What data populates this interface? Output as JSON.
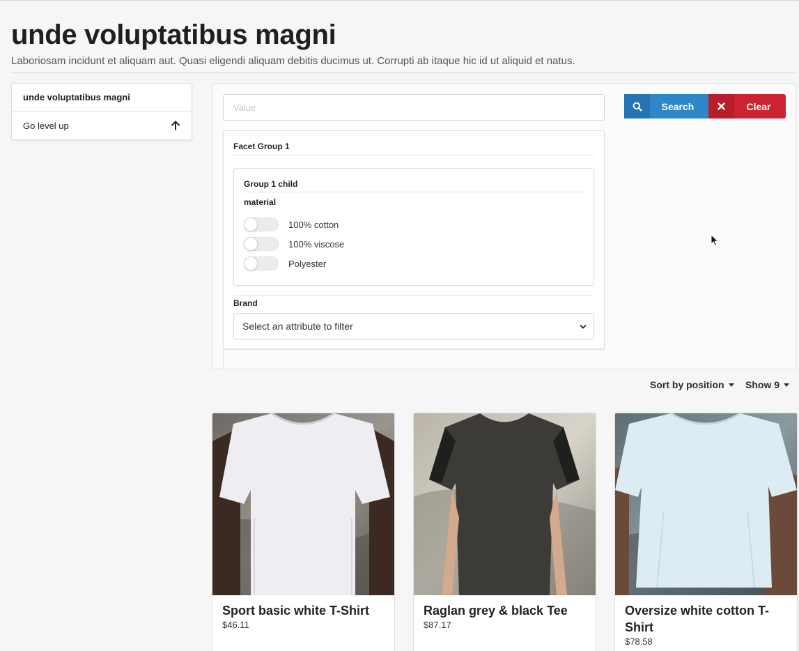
{
  "page": {
    "title": "unde voluptatibus magni",
    "subtitle": "Laboriosam incidunt et aliquam aut. Quasi eligendi aliquam debitis ducimus ut. Corrupti ab itaque hic id ut aliquid et natus."
  },
  "sidebar": {
    "category": "unde voluptatibus magni",
    "level_up_label": "Go level up",
    "level_up_icon": "arrow-up-icon"
  },
  "search": {
    "placeholder": "Value",
    "search_label": "Search",
    "search_icon": "search-icon",
    "clear_label": "Clear",
    "clear_icon": "close-icon"
  },
  "facets": {
    "group_title": "Facet Group 1",
    "child_title": "Group 1 child",
    "attribute_label": "material",
    "options": [
      "100% cotton",
      "100% viscose",
      "Polyester"
    ],
    "brand_label": "Brand",
    "brand_select": "Select an attribute to filter"
  },
  "sorting": {
    "sort_label": "Sort by position",
    "show_label": "Show 9"
  },
  "products": [
    {
      "name": "Sport basic white T-Shirt",
      "price": "$46.11"
    },
    {
      "name": "Raglan grey & black Tee",
      "price": "$87.17"
    },
    {
      "name": "Oversize white cotton T-Shirt",
      "price": "$78.58"
    }
  ],
  "colors": {
    "search_button": "#2f86c8",
    "clear_button": "#cc2231",
    "background": "#f5f6f5"
  }
}
